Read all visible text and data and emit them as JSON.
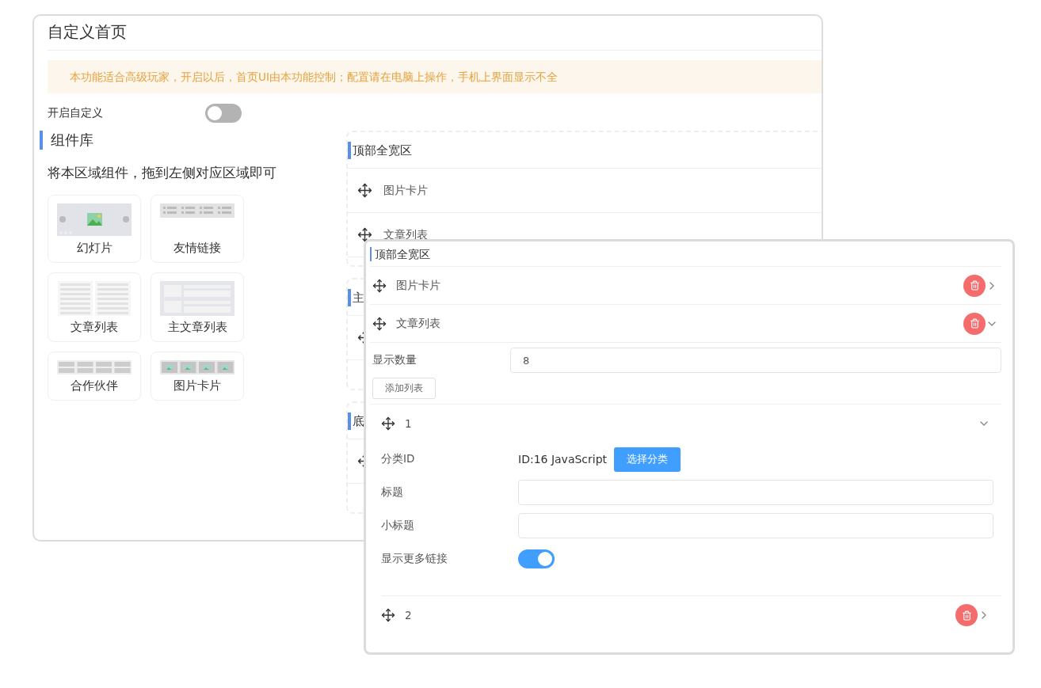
{
  "main_window": {
    "title": "自定义首页",
    "notice": "本功能适合高级玩家，开启以后，首页UI由本功能控制；配置请在电脑上操作，手机上界面显示不全",
    "enable_custom": {
      "label": "开启自定义",
      "on": false
    },
    "library": {
      "title": "组件库",
      "hint": "将本区域组件，拖到左侧对应区域即可",
      "components": [
        {
          "label": "幻灯片",
          "kind": "slider"
        },
        {
          "label": "友情链接",
          "kind": "links"
        },
        {
          "label": "文章列表",
          "kind": "list"
        },
        {
          "label": "主文章列表",
          "kind": "main-list"
        },
        {
          "label": "合作伙伴",
          "kind": "partners"
        },
        {
          "label": "图片卡片",
          "kind": "cards"
        }
      ]
    },
    "zones": [
      {
        "title": "顶部全宽区",
        "items": [
          {
            "kind": "labeled",
            "label": "图片卡片"
          },
          {
            "kind": "labeled",
            "label": "文章列表"
          }
        ]
      },
      {
        "title": "主",
        "items": [
          {
            "kind": "covered"
          }
        ]
      },
      {
        "title": "底",
        "items": [
          {
            "kind": "covered"
          }
        ]
      }
    ]
  },
  "editor": {
    "zone_title": "顶部全宽区",
    "items": [
      {
        "label": "图片卡片",
        "expanded": false,
        "deletable": true
      },
      {
        "label": "文章列表",
        "expanded": true,
        "deletable": true,
        "count_label": "显示数量",
        "count_value": "8",
        "add_button": "添加列表",
        "entries": [
          {
            "label": "1",
            "expanded": true,
            "deletable": false,
            "fields": [
              {
                "kind": "category",
                "label": "分类ID",
                "value": "ID:16 JavaScript",
                "button": "选择分类"
              },
              {
                "kind": "input",
                "label": "标题"
              },
              {
                "kind": "input",
                "label": "小标题"
              },
              {
                "kind": "switch",
                "label": "显示更多链接",
                "on": true
              }
            ]
          },
          {
            "label": "2",
            "expanded": false,
            "deletable": true
          }
        ]
      }
    ]
  }
}
